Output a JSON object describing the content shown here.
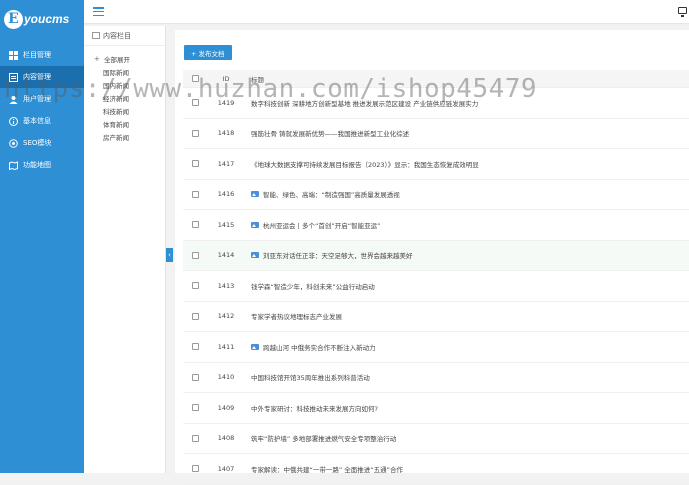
{
  "app": {
    "logo_letter": "E",
    "logo_text": "youcms",
    "brand_color": "#2f8fd4"
  },
  "sidebar": {
    "items": [
      {
        "label": "栏目管理",
        "icon": "grid-icon"
      },
      {
        "label": "内容管理",
        "icon": "document-icon",
        "active": true
      },
      {
        "label": "用户管理",
        "icon": "user-icon"
      },
      {
        "label": "基本信息",
        "icon": "info-icon"
      },
      {
        "label": "SEO模块",
        "icon": "seo-icon"
      },
      {
        "label": "功能地图",
        "icon": "map-icon"
      }
    ]
  },
  "tree": {
    "header": "内容栏目",
    "root": "全部展开",
    "items": [
      "国际新闻",
      "国内新闻",
      "经济新闻",
      "科技新闻",
      "体育新闻",
      "房产新闻"
    ]
  },
  "toolbar": {
    "publish_label": "+ 发布文档"
  },
  "table": {
    "headers": {
      "id": "ID",
      "title": "标题"
    },
    "rows": [
      {
        "id": "1419",
        "title": "数字科技创新 深耕地方创新型基地 推进发展示范区建设 产业链供应链发展实力",
        "image": false
      },
      {
        "id": "1418",
        "title": "强筋壮骨 铸就发展新优势——我国推进新型工业化综述",
        "image": false
      },
      {
        "id": "1417",
        "title": "《地球大数据支撑可持续发展目标报告（2023）》显示：我国生态恢复成效明显",
        "image": false
      },
      {
        "id": "1416",
        "title": "智能、绿色、高端：“制造强国”高质量发展透视",
        "image": true
      },
      {
        "id": "1415",
        "title": "杭州亚运会丨多个“首创”开启“智能亚运”",
        "image": true
      },
      {
        "id": "1414",
        "title": "刘亚东对话任正非：天空足够大，世界会越来越美好",
        "image": true
      },
      {
        "id": "1413",
        "title": "钱学森“智造少年，科创未来”公益行动启动",
        "image": false
      },
      {
        "id": "1412",
        "title": "专家学者热议地理标志产业发展",
        "image": false
      },
      {
        "id": "1411",
        "title": "跨越山河 中俄务实合作不断注入新动力",
        "image": true
      },
      {
        "id": "1410",
        "title": "中国科技馆开馆35周年推出系列科普活动",
        "image": false
      },
      {
        "id": "1409",
        "title": "中外专家研讨：科技推动未来发展方向如何?",
        "image": false
      },
      {
        "id": "1408",
        "title": "筑牢“防护墙” 多地部署推进燃气安全专项整治行动",
        "image": false
      },
      {
        "id": "1407",
        "title": "专家解读：中俄共建“一带一路” 全面推进“五通”合作",
        "image": false
      }
    ]
  },
  "watermark": "https://www.huzhan.com/ishop45479"
}
